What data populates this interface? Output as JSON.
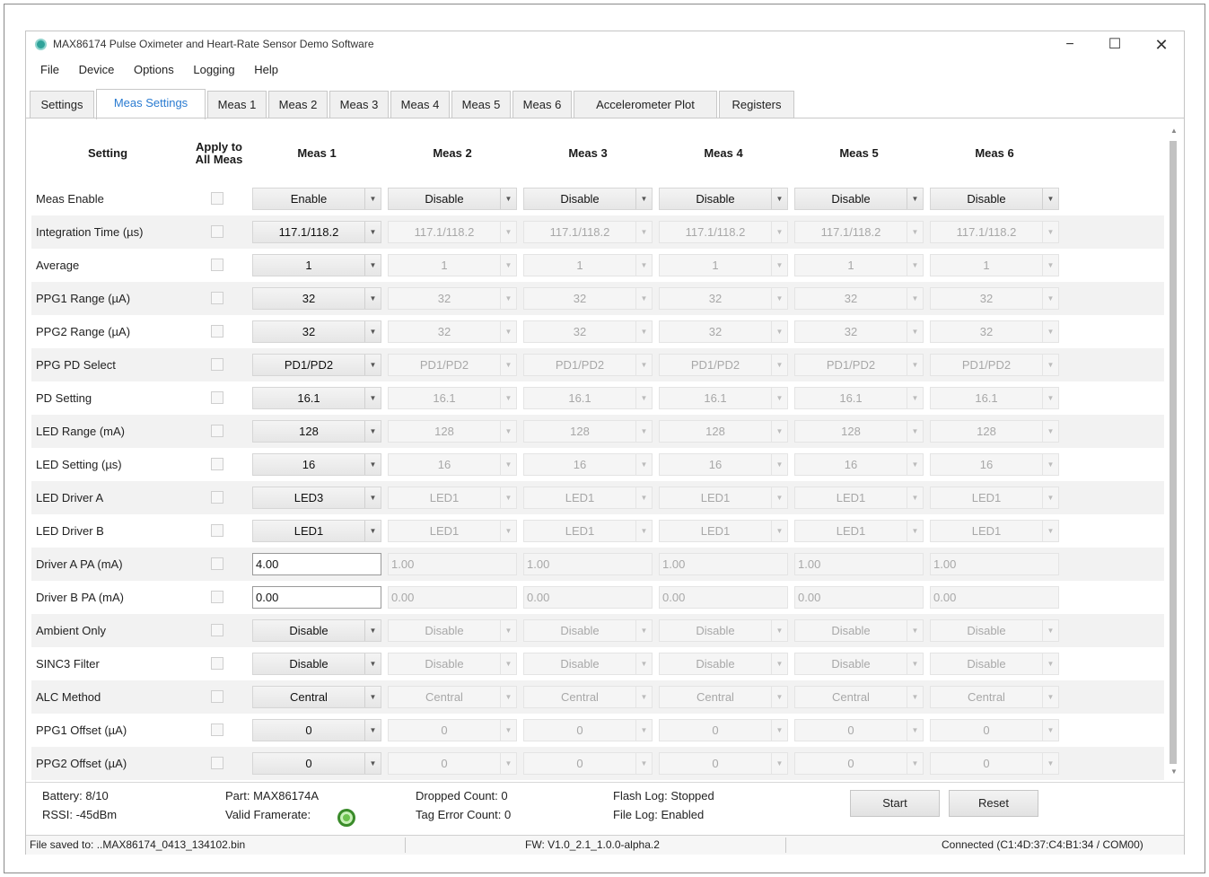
{
  "window": {
    "title": "MAX86174 Pulse Oximeter and Heart-Rate Sensor Demo Software",
    "minimize": "−",
    "maximize": "☐",
    "close": "✕"
  },
  "menu": [
    "File",
    "Device",
    "Options",
    "Logging",
    "Help"
  ],
  "tabs": [
    {
      "label": "Settings",
      "active": false
    },
    {
      "label": "Meas Settings",
      "active": true
    },
    {
      "label": "Meas 1",
      "active": false
    },
    {
      "label": "Meas 2",
      "active": false
    },
    {
      "label": "Meas 3",
      "active": false
    },
    {
      "label": "Meas 4",
      "active": false
    },
    {
      "label": "Meas 5",
      "active": false
    },
    {
      "label": "Meas 6",
      "active": false
    },
    {
      "label": "Accelerometer Plot",
      "active": false
    },
    {
      "label": "Registers",
      "active": false
    }
  ],
  "grid": {
    "headers": {
      "setting": "Setting",
      "apply_all": "Apply to All Meas",
      "meas": [
        "Meas 1",
        "Meas 2",
        "Meas 3",
        "Meas 4",
        "Meas 5",
        "Meas 6"
      ]
    },
    "rows": [
      {
        "label": "Meas Enable",
        "type": "combo",
        "first": "Enable",
        "others": "Disable",
        "others_enabled": true
      },
      {
        "label": "Integration Time (µs)",
        "type": "combo",
        "first": "117.1/118.2",
        "others": "117.1/118.2",
        "others_enabled": false
      },
      {
        "label": "Average",
        "type": "combo",
        "first": "1",
        "others": "1",
        "others_enabled": false
      },
      {
        "label": "PPG1 Range (µA)",
        "type": "combo",
        "first": "32",
        "others": "32",
        "others_enabled": false
      },
      {
        "label": "PPG2 Range (µA)",
        "type": "combo",
        "first": "32",
        "others": "32",
        "others_enabled": false
      },
      {
        "label": "PPG PD Select",
        "type": "combo",
        "first": "PD1/PD2",
        "others": "PD1/PD2",
        "others_enabled": false
      },
      {
        "label": "PD Setting",
        "type": "combo",
        "first": "16.1",
        "others": "16.1",
        "others_enabled": false
      },
      {
        "label": "LED Range (mA)",
        "type": "combo",
        "first": "128",
        "others": "128",
        "others_enabled": false
      },
      {
        "label": "LED Setting (µs)",
        "type": "combo",
        "first": "16",
        "others": "16",
        "others_enabled": false
      },
      {
        "label": "LED Driver A",
        "type": "combo",
        "first": "LED3",
        "others": "LED1",
        "others_enabled": false
      },
      {
        "label": "LED Driver B",
        "type": "combo",
        "first": "LED1",
        "others": "LED1",
        "others_enabled": false
      },
      {
        "label": "Driver A PA (mA)",
        "type": "field",
        "first": "4.00",
        "others": "1.00",
        "others_enabled": false
      },
      {
        "label": "Driver B PA (mA)",
        "type": "field",
        "first": "0.00",
        "others": "0.00",
        "others_enabled": false
      },
      {
        "label": "Ambient Only",
        "type": "combo",
        "first": "Disable",
        "others": "Disable",
        "others_enabled": false
      },
      {
        "label": "SINC3 Filter",
        "type": "combo",
        "first": "Disable",
        "others": "Disable",
        "others_enabled": false
      },
      {
        "label": "ALC Method",
        "type": "combo",
        "first": "Central",
        "others": "Central",
        "others_enabled": false
      },
      {
        "label": "PPG1 Offset (µA)",
        "type": "combo",
        "first": "0",
        "others": "0",
        "others_enabled": false
      },
      {
        "label": "PPG2 Offset (µA)",
        "type": "combo",
        "first": "0",
        "others": "0",
        "others_enabled": false
      }
    ]
  },
  "scroll": {
    "up": "▲",
    "down": "▼"
  },
  "status": {
    "battery": "Battery: 8/10",
    "rssi": "RSSI: -45dBm",
    "part": "Part: MAX86174A",
    "valid_framerate": "Valid Framerate:",
    "dropped_count": "Dropped Count: 0",
    "tag_error_count": "Tag Error Count: 0",
    "flash_log": "Flash Log: Stopped",
    "file_log": "File Log: Enabled",
    "start_label": "Start",
    "reset_label": "Reset",
    "framerate_color": "#6dc24f"
  },
  "statusbar": {
    "file_saved": "File saved to: ..MAX86174_0413_134102.bin",
    "fw": "FW: V1.0_2.1_1.0.0-alpha.2",
    "connected": "Connected (C1:4D:37:C4:B1:34 / COM00)"
  }
}
